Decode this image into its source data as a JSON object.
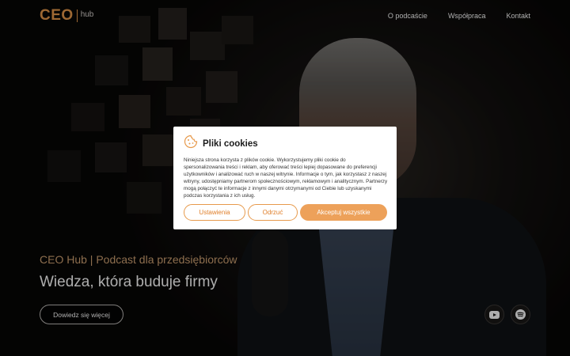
{
  "brand": {
    "logo_main": "CEO",
    "logo_sub": "hub",
    "accent": "#e79a4c"
  },
  "nav": {
    "items": [
      {
        "label": "O podcaście"
      },
      {
        "label": "Współpraca"
      },
      {
        "label": "Kontakt"
      }
    ]
  },
  "hero": {
    "eyebrow": "CEO Hub | Podcast dla przedsiębiorców",
    "headline": "Wiedza, która buduje firmy",
    "cta_label": "Dowiedz się więcej",
    "social_icons": [
      "youtube-icon",
      "spotify-icon"
    ]
  },
  "cookie": {
    "icon": "cookie-icon",
    "title": "Pliki cookies",
    "body": "Niniejsza strona korzysta z plików cookie. Wykorzystujemy pliki cookie do spersonalizowania treści i reklam, aby oferować treści lepiej dopasowane do preferencji użytkowników i analizować ruch w naszej witrynie. Informacje o tym, jak korzystasz z naszej witryny, udostępniamy partnerom społecznościowym, reklamowym i analitycznym. Partnerzy mogą połączyć te informacje z innymi danymi otrzymanymi od Ciebie lub uzyskanymi podczas korzystania z ich usług.",
    "settings_label": "Ustawienia",
    "reject_label": "Odrzuć",
    "accept_label": "Akceptuj wszystkie"
  }
}
